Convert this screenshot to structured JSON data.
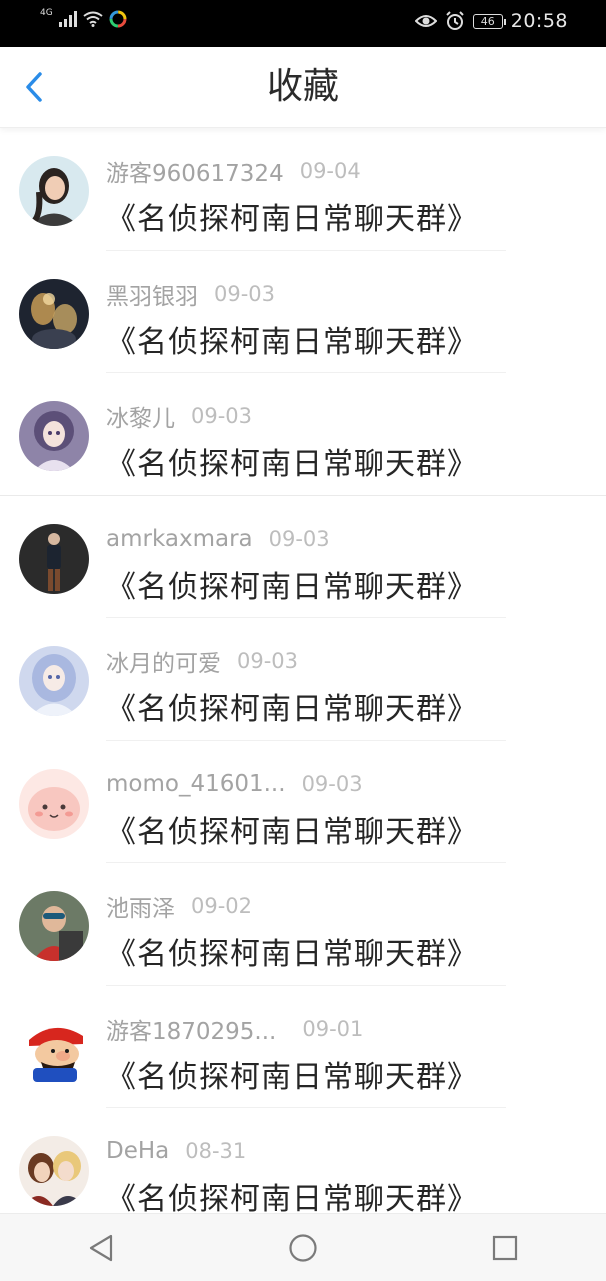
{
  "status_bar": {
    "network": "4G",
    "battery": "46",
    "time": "20:58"
  },
  "header": {
    "title": "收藏",
    "back_icon": "chevron-left-icon",
    "accent_color": "#2a8ce8"
  },
  "favorites": [
    {
      "user": "游客960617324",
      "date": "09-04",
      "content": "《名侦探柯南日常聊天群》",
      "avatar": "avatar-girl-photo"
    },
    {
      "user": "黑羽银羽",
      "date": "09-03",
      "content": "《名侦探柯南日常聊天群》",
      "avatar": "avatar-dark-art"
    },
    {
      "user": "冰黎儿",
      "date": "09-03",
      "content": "《名侦探柯南日常聊天群》",
      "avatar": "avatar-anime-doll"
    },
    {
      "user": "amrkaxmara",
      "date": "09-03",
      "content": "《名侦探柯南日常聊天群》",
      "avatar": "avatar-person-photo"
    },
    {
      "user": "冰月的可爱",
      "date": "09-03",
      "content": "《名侦探柯南日常聊天群》",
      "avatar": "avatar-anime-snow"
    },
    {
      "user": "momo_41601...",
      "date": "09-03",
      "content": "《名侦探柯南日常聊天群》",
      "avatar": "avatar-pink-cartoon"
    },
    {
      "user": "池雨泽",
      "date": "09-02",
      "content": "《名侦探柯南日常聊天群》",
      "avatar": "avatar-kid-photo"
    },
    {
      "user": "游客1870295...",
      "date": "09-01",
      "content": "《名侦探柯南日常聊天群》",
      "avatar": "avatar-mario"
    },
    {
      "user": "DeHa",
      "date": "08-31",
      "content": "《名侦探柯南日常聊天群》",
      "avatar": "avatar-anime-pair"
    }
  ],
  "nav_bar": {
    "back": "triangle-back-icon",
    "home": "circle-home-icon",
    "recents": "square-recents-icon"
  }
}
